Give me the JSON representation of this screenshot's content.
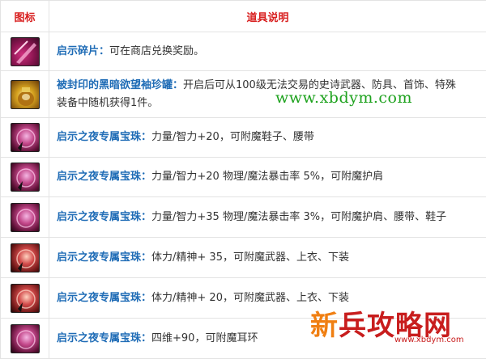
{
  "header": {
    "col_icon": "图标",
    "col_desc": "道具说明"
  },
  "rows": [
    {
      "icon": "shard-icon",
      "name": "启示碎片：",
      "text": "可在商店兑换奖励。"
    },
    {
      "icon": "jar-icon",
      "name": "被封印的黑暗欲望袖珍罐：",
      "text": "开启后可从100级无法交易的史诗武器、防具、首饰、特殊",
      "text2": "装备中随机获得1件。"
    },
    {
      "icon": "orb-icon",
      "name": "启示之夜专属宝珠：",
      "text": "力量/智力+20，可附魔鞋子、腰带"
    },
    {
      "icon": "orb-icon",
      "name": "启示之夜专属宝珠：",
      "text": "力量/智力+20 物理/魔法暴击率 5%，可附魔护肩"
    },
    {
      "icon": "orb-icon",
      "name": "启示之夜专属宝珠：",
      "text": "力量/智力+35 物理/魔法暴击率 3%，可附魔护肩、腰带、鞋子"
    },
    {
      "icon": "orb-icon",
      "name": "启示之夜专属宝珠：",
      "text": "体力/精神+ 35，可附魔武器、上衣、下装"
    },
    {
      "icon": "orb-icon",
      "name": "启示之夜专属宝珠：",
      "text": "体力/精神+ 20，可附魔武器、上衣、下装"
    },
    {
      "icon": "orb-icon",
      "name": "启示之夜专属宝珠：",
      "text": "四维+90，可附魔耳环"
    }
  ],
  "watermark": "www.xbdym.com",
  "logo": {
    "xin": "新",
    "rest": "兵攻略网",
    "url": "www.xbdym.com"
  }
}
